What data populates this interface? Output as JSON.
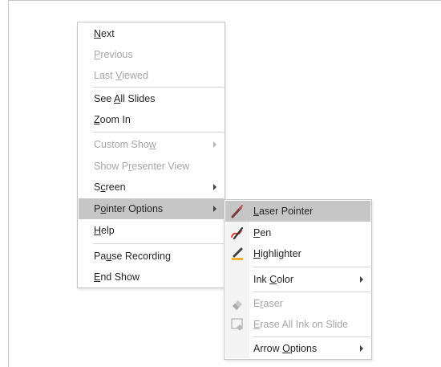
{
  "main_menu": {
    "items": [
      {
        "pre": "",
        "key": "N",
        "post": "ext",
        "disabled": false
      },
      {
        "pre": "",
        "key": "P",
        "post": "revious",
        "disabled": true
      },
      {
        "pre": "Last ",
        "key": "V",
        "post": "iewed",
        "disabled": true
      },
      {
        "pre": "See ",
        "key": "A",
        "post": "ll Slides",
        "disabled": false
      },
      {
        "pre": "",
        "key": "Z",
        "post": "oom In",
        "disabled": false
      },
      {
        "pre": "Custom Sho",
        "key": "w",
        "post": "",
        "disabled": true
      },
      {
        "pre": "Show P",
        "key": "r",
        "post": "esenter View",
        "disabled": true
      },
      {
        "pre": "S",
        "key": "c",
        "post": "reen",
        "disabled": false
      },
      {
        "pre": "P",
        "key": "o",
        "post": "inter Options",
        "disabled": false
      },
      {
        "pre": "",
        "key": "H",
        "post": "elp",
        "disabled": false
      },
      {
        "pre": "Pa",
        "key": "u",
        "post": "se Recording",
        "disabled": false
      },
      {
        "pre": "",
        "key": "E",
        "post": "nd Show",
        "disabled": false
      }
    ]
  },
  "sub_menu": {
    "items": [
      {
        "pre": "",
        "key": "L",
        "post": "aser Pointer",
        "disabled": false,
        "icon": "laser-pointer-icon"
      },
      {
        "pre": "",
        "key": "P",
        "post": "en",
        "disabled": false,
        "icon": "pen-icon"
      },
      {
        "pre": "",
        "key": "H",
        "post": "ighlighter",
        "disabled": false,
        "icon": "highlighter-icon"
      },
      {
        "pre": "Ink ",
        "key": "C",
        "post": "olor",
        "disabled": false,
        "icon": ""
      },
      {
        "pre": "E",
        "key": "r",
        "post": "aser",
        "disabled": true,
        "icon": "eraser-icon"
      },
      {
        "pre": "",
        "key": "E",
        "post": "rase All Ink on Slide",
        "disabled": true,
        "icon": "erase-all-ink-icon"
      },
      {
        "pre": "Arrow ",
        "key": "O",
        "post": "ptions",
        "disabled": false,
        "icon": ""
      }
    ]
  },
  "colors": {
    "highlight": "#c6c6c6",
    "disabled_text": "#a6a6a6",
    "laser": "#c0504d",
    "pen": "#e0403a",
    "highlighter": "#f0b030"
  }
}
